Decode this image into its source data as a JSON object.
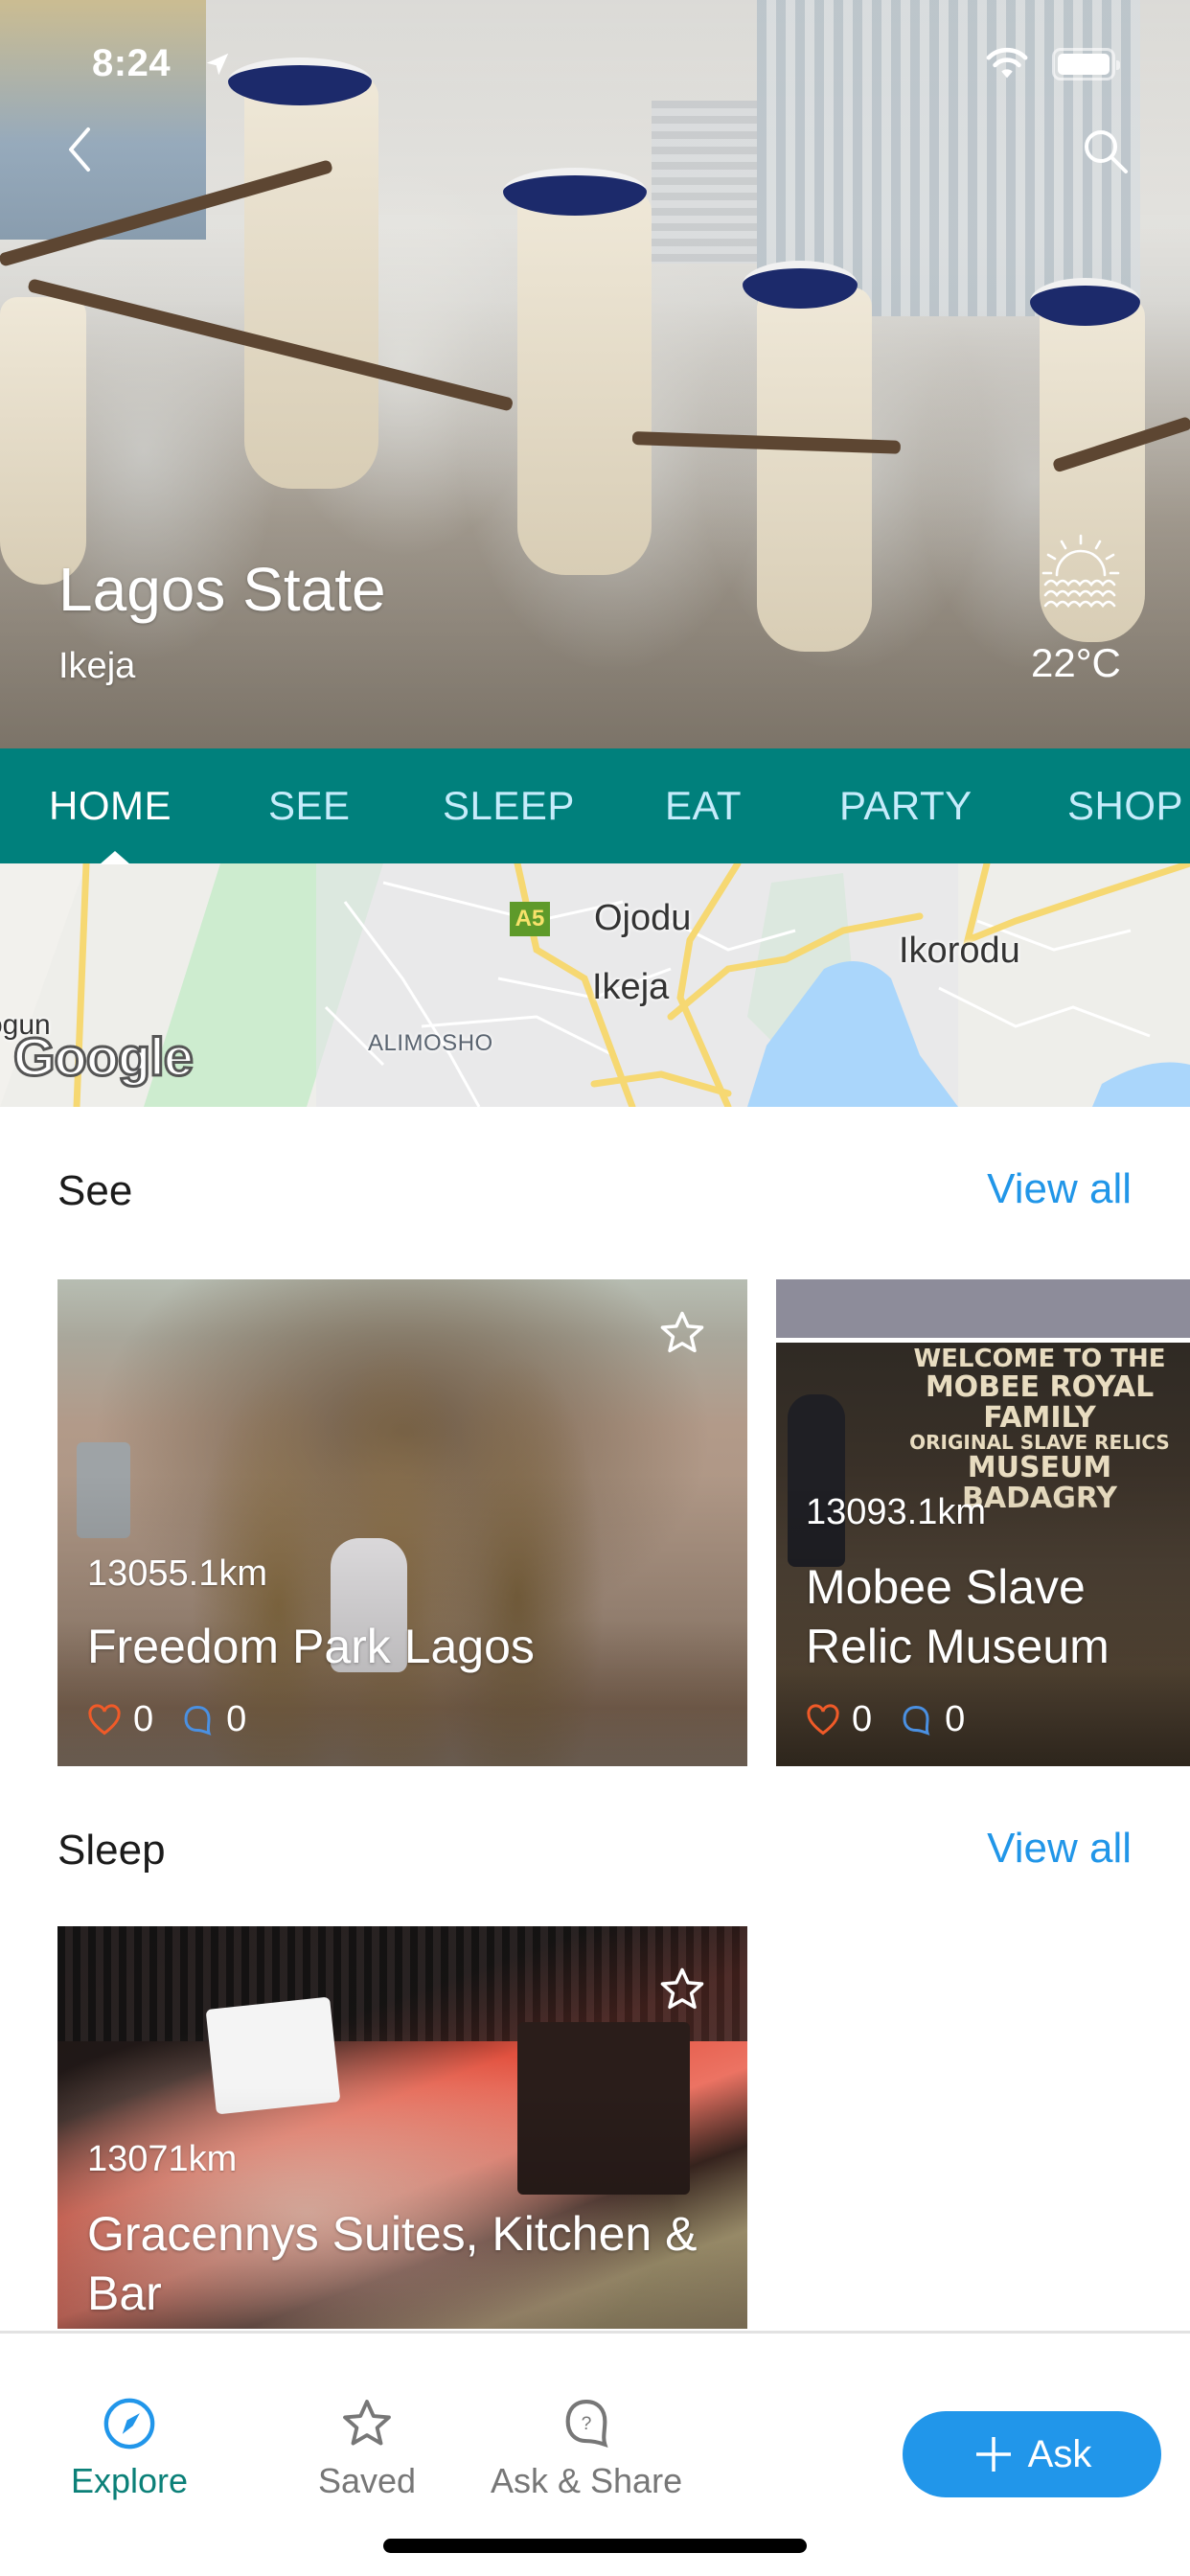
{
  "status_bar": {
    "time": "8:24",
    "location_icon": "location-arrow-icon",
    "wifi_icon": "wifi-icon",
    "battery_icon": "battery-icon"
  },
  "header": {
    "back_icon": "chevron-left-icon",
    "search_icon": "search-icon",
    "title": "Lagos State",
    "subtitle": "Ikeja",
    "weather": {
      "icon": "sunset-sea-icon",
      "temperature": "22°C"
    }
  },
  "tabs": [
    {
      "label": "HOME",
      "active": true
    },
    {
      "label": "SEE",
      "active": false
    },
    {
      "label": "SLEEP",
      "active": false
    },
    {
      "label": "EAT",
      "active": false
    },
    {
      "label": "PARTY",
      "active": false
    },
    {
      "label": "SHOP",
      "active": false
    }
  ],
  "map": {
    "labels": {
      "ojodu": "Ojodu",
      "ikeja": "Ikeja",
      "ikorodu": "Ikorodu",
      "alimosho": "ALIMOSHO",
      "edge": "ogun"
    },
    "road_shield": "A5",
    "attribution": "Google"
  },
  "sections": {
    "see": {
      "title": "See",
      "view_all": "View all",
      "cards": [
        {
          "distance": "13055.1km",
          "name": "Freedom Park Lagos",
          "likes": "0",
          "comments": "0",
          "saved": false
        },
        {
          "distance": "13093.1km",
          "name": "Mobee Slave Relic Museum",
          "likes": "0",
          "comments": "0",
          "sign": [
            "WELCOME TO THE",
            "MOBEE ROYAL FAMILY",
            "ORIGINAL SLAVE RELICS",
            "MUSEUM BADAGRY"
          ]
        }
      ]
    },
    "sleep": {
      "title": "Sleep",
      "view_all": "View all",
      "cards": [
        {
          "distance": "13071km",
          "name": "Gracennys Suites, Kitchen & Bar",
          "saved": false
        }
      ]
    }
  },
  "bottom_nav": {
    "items": [
      {
        "label": "Explore",
        "icon": "compass-icon",
        "active": true
      },
      {
        "label": "Saved",
        "icon": "star-icon",
        "active": false
      },
      {
        "label": "Ask & Share",
        "icon": "question-bubble-icon",
        "active": false
      }
    ],
    "ask_button": "Ask"
  },
  "colors": {
    "tab_bar": "#00807c",
    "accent_blue": "#2196ea",
    "explore_active": "#0b8078",
    "like": "#f05a28",
    "comment": "#4a90e2"
  }
}
